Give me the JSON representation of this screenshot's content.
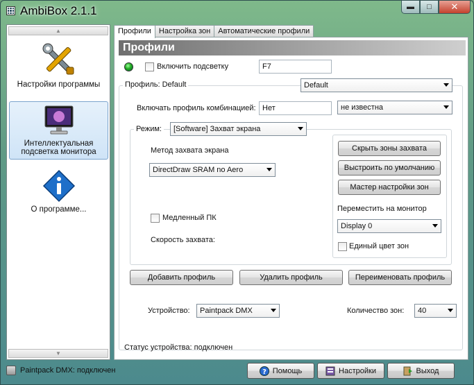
{
  "window": {
    "title": "AmbiBox 2.1.1",
    "minimize": "▬",
    "maximize": "□",
    "close": "✕"
  },
  "sidebar": {
    "items": [
      {
        "label": "Настройки программы",
        "icon": "tools-icon"
      },
      {
        "label": "Интеллектуальная подсветка монитора",
        "icon": "monitor-icon"
      },
      {
        "label": "О программе...",
        "icon": "info-icon"
      }
    ]
  },
  "tabs": [
    {
      "label": "Профили"
    },
    {
      "label": "Настройка зон"
    },
    {
      "label": "Автоматические профили"
    }
  ],
  "section_title": "Профили",
  "enable_backlight": {
    "label": "Включить подсветку",
    "hotkey": "F7"
  },
  "profile": {
    "label": "Профиль: Default",
    "value": "Default"
  },
  "profile_combo": {
    "label": "Включать профиль комбинацией:",
    "value": "Нет",
    "select_value": "не известна"
  },
  "mode": {
    "label": "Режим:",
    "value": "[Software] Захват экрана"
  },
  "capture": {
    "method_label": "Метод захвата экрана",
    "method_value": "DirectDraw SRAM no Aero",
    "slow_pc_label": "Медленный ПК",
    "speed_label": "Скорость захвата:"
  },
  "zones": {
    "hide_label": "Скрыть зоны захвата",
    "default_label": "Выстроить по умолчанию",
    "wizard_label": "Мастер настройки зон",
    "move_label": "Переместить на монитор",
    "display_value": "Display 0",
    "single_color_label": "Единый цвет зон"
  },
  "profile_buttons": {
    "add": "Добавить профиль",
    "delete": "Удалить профиль",
    "rename": "Переименовать профиль"
  },
  "device": {
    "label": "Устройство:",
    "value": "Paintpack DMX",
    "zones_label": "Количество зон:",
    "zones_value": "40"
  },
  "device_status": "Статус устройства: подключен",
  "statusbar": {
    "left": "Paintpack DMX: подключен",
    "help": "Помощь",
    "settings": "Настройки",
    "exit": "Выход"
  }
}
